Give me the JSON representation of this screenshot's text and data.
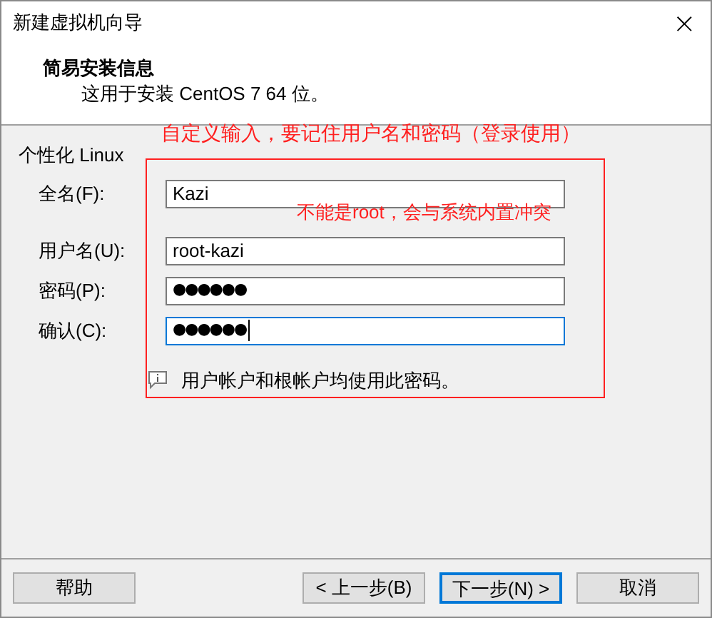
{
  "window": {
    "title": "新建虚拟机向导",
    "close": "×"
  },
  "header": {
    "title": "简易安装信息",
    "subtitle": "这用于安装 CentOS 7 64 位。"
  },
  "section": {
    "title": "个性化 Linux"
  },
  "fields": [
    {
      "label": "全名(F):",
      "value": "Kazi",
      "focused": false
    },
    {
      "label": "用户名(U):",
      "value": "root-kazi",
      "focused": false
    },
    {
      "label": "密码(P):",
      "value": "●●●●●●",
      "focused": false
    },
    {
      "label": "确认(C):",
      "value": "●●●●●●",
      "focused": true
    }
  ],
  "note": "用户帐户和根帐户均使用此密码。",
  "annotations": [
    {
      "kind": "heading",
      "text": "自定义输入，要记住用户名和密码（登录使用）"
    },
    {
      "kind": "frame"
    },
    {
      "kind": "inline",
      "text": "不能是root，会与系统内置冲突"
    }
  ],
  "buttons": [
    {
      "label": "帮助",
      "default": false
    },
    {
      "label": "< 上一步(B)",
      "default": false
    },
    {
      "label": "下一步(N) >",
      "default": true
    },
    {
      "label": "取消",
      "default": false
    }
  ]
}
